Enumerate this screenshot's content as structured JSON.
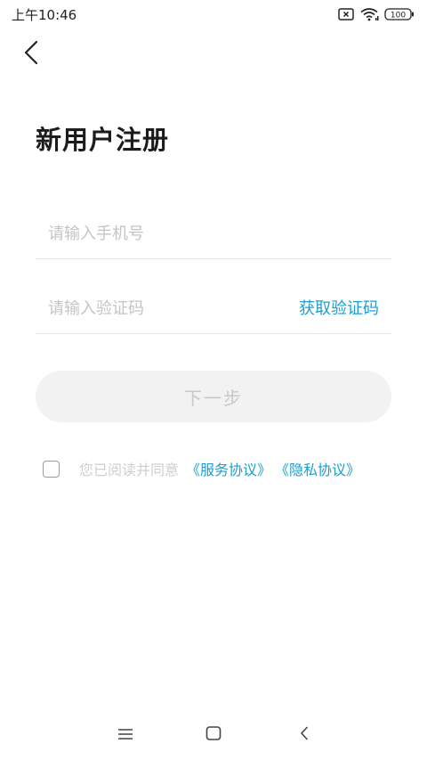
{
  "status_bar": {
    "time": "上午10:46",
    "battery": "100",
    "icons": [
      "sim-card-x-icon",
      "wifi-icon",
      "battery-icon"
    ]
  },
  "header": {
    "back_icon": "chevron-left-icon"
  },
  "page": {
    "title": "新用户注册"
  },
  "form": {
    "phone_placeholder": "请输入手机号",
    "code_placeholder": "请输入验证码",
    "get_code_label": "获取验证码",
    "next_label": "下一步"
  },
  "agreement": {
    "checked": false,
    "text": "您已阅读并同意",
    "service_link": "《服务协议》",
    "privacy_link": "《隐私协议》"
  },
  "nav_bar": {
    "icons": [
      "menu-icon",
      "home-icon",
      "back-icon"
    ]
  },
  "colors": {
    "accent": "#1a9fd0",
    "button_disabled_bg": "#f2f2f2",
    "button_disabled_text": "#c8c8c8",
    "placeholder": "#c4c4c4"
  }
}
